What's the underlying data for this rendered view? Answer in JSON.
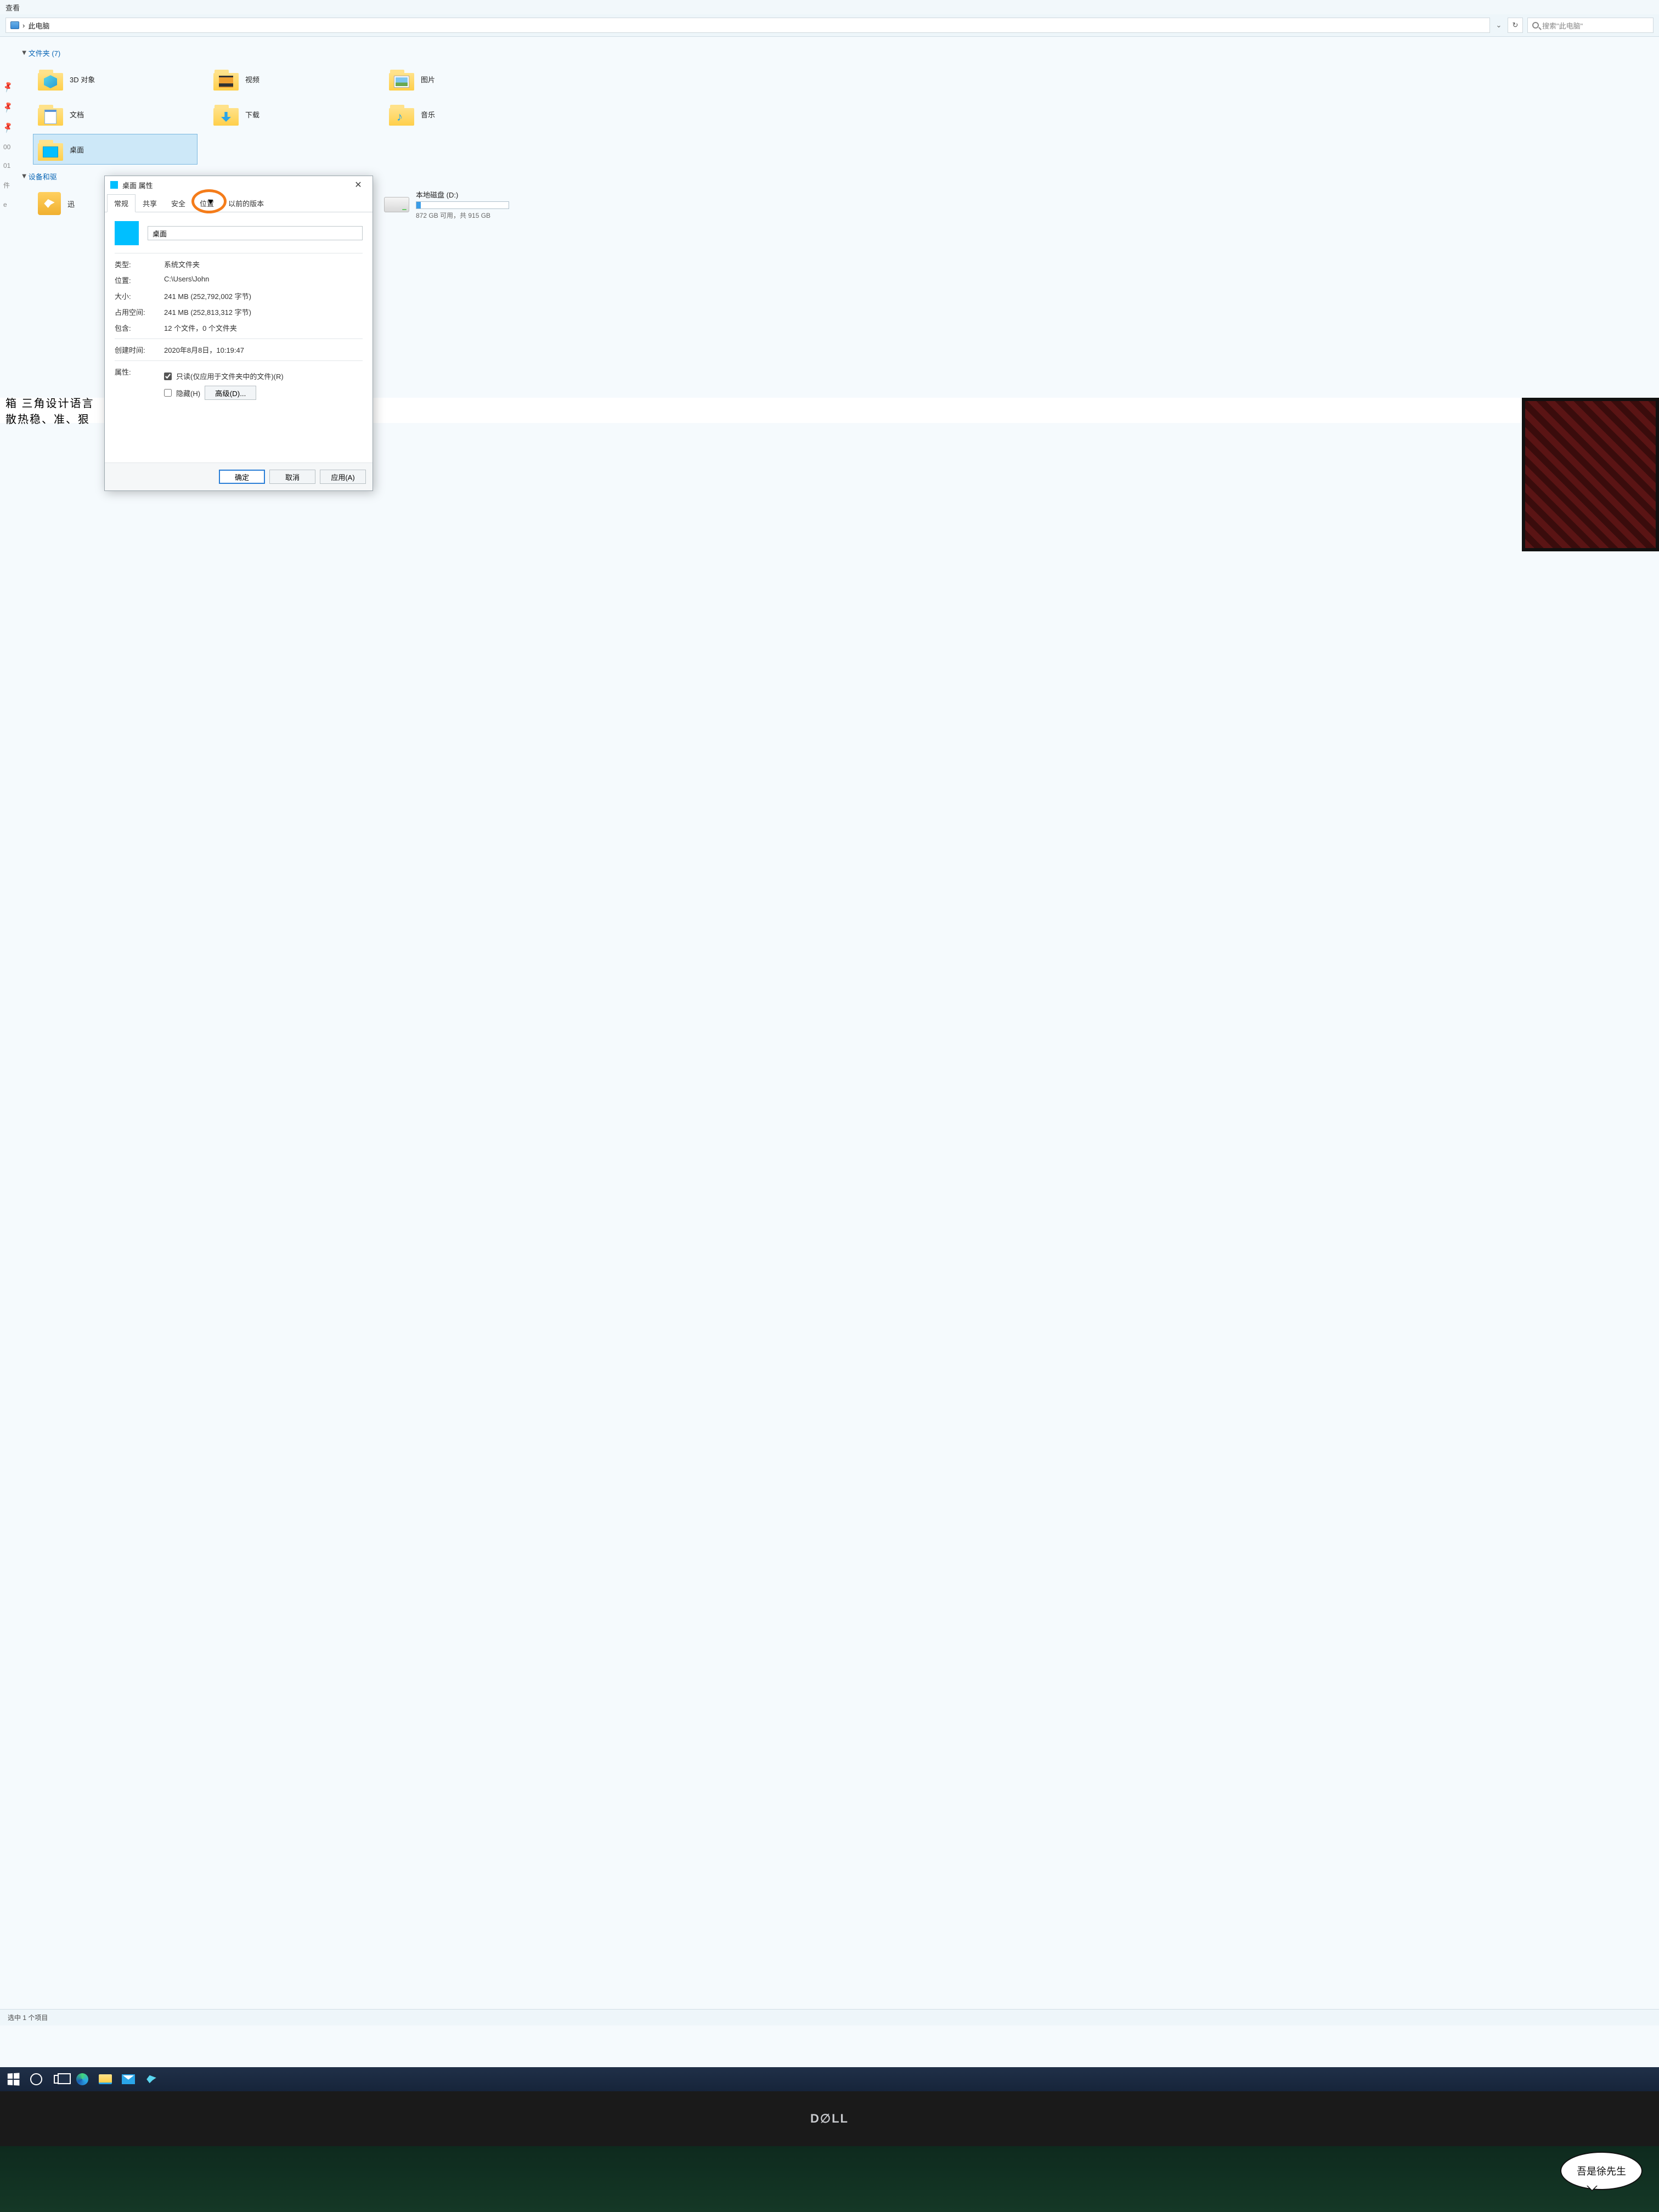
{
  "toolbar": {
    "view_label": "查看"
  },
  "address": {
    "path_text": "此电脑",
    "separator": "›",
    "search_placeholder": "搜索\"此电脑\""
  },
  "sections": {
    "folders_header": "文件夹 (7)",
    "devices_header": "设备和驱"
  },
  "folders": {
    "objects3d": "3D 对象",
    "videos": "视频",
    "pictures": "图片",
    "documents": "文档",
    "downloads": "下载",
    "music": "音乐",
    "desktop": "桌面",
    "thunder": "迅"
  },
  "drive": {
    "name": "本地磁盘 (D:)",
    "free_text": "872 GB 可用，共 915 GB"
  },
  "left_labels": {
    "l1": "00",
    "l2": "01",
    "l3": "件",
    "l4": "e"
  },
  "statusbar": {
    "text": "选中 1 个项目"
  },
  "dialog": {
    "title": "桌面 属性",
    "tabs": {
      "general": "常规",
      "sharing": "共享",
      "security": "安全",
      "location": "位置",
      "previous": "以前的版本"
    },
    "name_value": "桌面",
    "rows": {
      "type_lbl": "类型:",
      "type_val": "系统文件夹",
      "loc_lbl": "位置:",
      "loc_val": "C:\\Users\\John",
      "size_lbl": "大小:",
      "size_val": "241 MB (252,792,002 字节)",
      "ondisk_lbl": "占用空间:",
      "ondisk_val": "241 MB (252,813,312 字节)",
      "contains_lbl": "包含:",
      "contains_val": "12 个文件，0 个文件夹",
      "created_lbl": "创建时间:",
      "created_val": "2020年8月8日，10:19:47",
      "attr_lbl": "属性:",
      "readonly": "只读(仅应用于文件夹中的文件)(R)",
      "hidden": "隐藏(H)",
      "advanced": "高级(D)..."
    },
    "buttons": {
      "ok": "确定",
      "cancel": "取消",
      "apply": "应用(A)"
    }
  },
  "ad": {
    "line1": "箱  三角设计语言",
    "line2": "散热稳、准、狠"
  },
  "monitor_brand": "D∅LL",
  "watermark": "吾是徐先生"
}
